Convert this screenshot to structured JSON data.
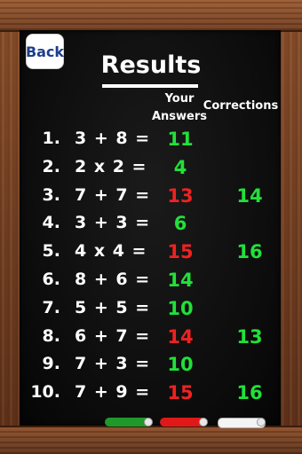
{
  "back_label": "Back",
  "title": "Results",
  "headers": {
    "answers_line1": "Your",
    "answers_line2": "Answers",
    "corrections": "Corrections"
  },
  "rows": [
    {
      "num": "1.",
      "eq": "3 + 8 =",
      "ans": "11",
      "correct": true,
      "corr": ""
    },
    {
      "num": "2.",
      "eq": "2 x 2 =",
      "ans": "4",
      "correct": true,
      "corr": ""
    },
    {
      "num": "3.",
      "eq": "7 + 7 =",
      "ans": "13",
      "correct": false,
      "corr": "14"
    },
    {
      "num": "4.",
      "eq": "3 + 3 =",
      "ans": "6",
      "correct": true,
      "corr": ""
    },
    {
      "num": "5.",
      "eq": "4 x 4 =",
      "ans": "15",
      "correct": false,
      "corr": "16"
    },
    {
      "num": "6.",
      "eq": "8 + 6 =",
      "ans": "14",
      "correct": true,
      "corr": ""
    },
    {
      "num": "7.",
      "eq": "5 + 5 =",
      "ans": "10",
      "correct": true,
      "corr": ""
    },
    {
      "num": "8.",
      "eq": "6 + 7 =",
      "ans": "14",
      "correct": false,
      "corr": "13"
    },
    {
      "num": "9.",
      "eq": "7 + 3 =",
      "ans": "10",
      "correct": true,
      "corr": ""
    },
    {
      "num": "10.",
      "eq": "7 + 9 =",
      "ans": "15",
      "correct": false,
      "corr": "16"
    }
  ],
  "chalks": [
    {
      "name": "green-chalk",
      "color": "#1f9a2a"
    },
    {
      "name": "red-chalk",
      "color": "#e01818"
    },
    {
      "name": "white-chalk",
      "color": "#f4f4f4"
    }
  ]
}
